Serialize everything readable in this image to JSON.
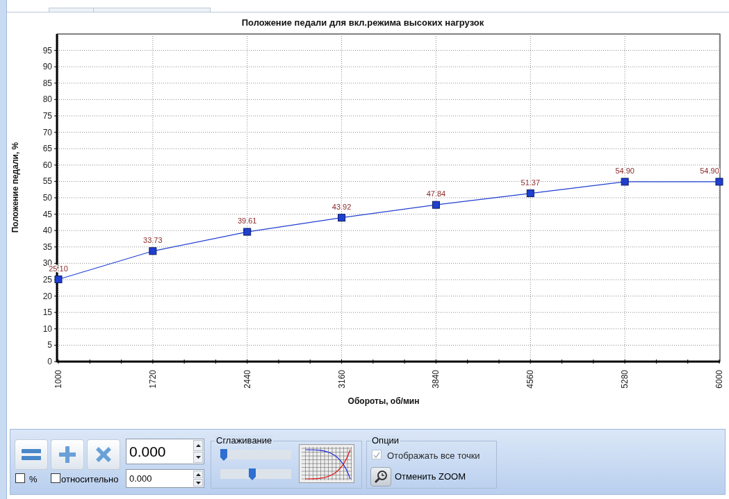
{
  "chart": {
    "chart_data": {
      "type": "line",
      "title": "Положение педали для вкл.режима высоких нагрузок",
      "xlabel": "Обороты, об/мин",
      "ylabel": "Положение педали, %",
      "categories": [
        "1000",
        "1720",
        "2440",
        "3160",
        "3840",
        "4560",
        "5280",
        "6000"
      ],
      "grid": true,
      "series": [
        {
          "color": "#1f3fd0",
          "marker": "square",
          "values": [
            25.1,
            33.73,
            39.61,
            43.92,
            47.84,
            51.37,
            54.9,
            54.9
          ]
        }
      ],
      "value_labels": [
        "25.10",
        "33.73",
        "39.61",
        "43.92",
        "47.84",
        "51.37",
        "54.90",
        "54.90"
      ],
      "ylim": [
        0,
        100
      ],
      "yticks": [
        0,
        5,
        10,
        15,
        20,
        25,
        30,
        35,
        40,
        45,
        50,
        55,
        60,
        65,
        70,
        75,
        80,
        85,
        90,
        95
      ]
    }
  },
  "toolbar": {
    "buttons": [
      {
        "kind": "equals"
      },
      {
        "kind": "plus"
      },
      {
        "kind": "cross"
      }
    ],
    "value_field": {
      "value": "0.000"
    },
    "percent_checkbox": {
      "label": "%",
      "checked": false
    },
    "relative_checkbox": {
      "label": "относительно",
      "checked": false
    },
    "relative_field": {
      "value": "0.000"
    },
    "smoothing": {
      "title": "Сглаживание",
      "sliders": [
        {
          "level": 0.05
        },
        {
          "level": 0.45
        }
      ]
    },
    "options": {
      "title": "Опции",
      "show_all_points": {
        "label": "Отображать все точки",
        "checked": true,
        "disabled": true
      },
      "reset_zoom": {
        "label": "Отменить ZOOM"
      }
    }
  }
}
